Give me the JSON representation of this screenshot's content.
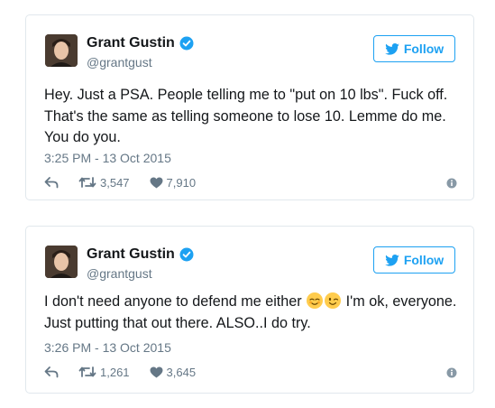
{
  "colors": {
    "accent": "#1da1f2",
    "secondary_text": "#657786",
    "border": "#e1e8ed"
  },
  "tweets": [
    {
      "author": {
        "display_name": "Grant Gustin",
        "handle": "@grantgust",
        "verified": true
      },
      "follow_label": "Follow",
      "text": "Hey. Just a PSA. People telling me to \"put on 10 lbs\". Fuck off. That's the same as telling someone to lose 10. Lemme do me. You do you.",
      "timestamp": "3:25 PM - 13 Oct 2015",
      "retweets": "3,547",
      "likes": "7,910",
      "icons": [
        "reply-icon",
        "retweet-icon",
        "heart-icon",
        "info-icon"
      ]
    },
    {
      "author": {
        "display_name": "Grant Gustin",
        "handle": "@grantgust",
        "verified": true
      },
      "follow_label": "Follow",
      "text_before_emoji": "I don't need anyone to defend me either",
      "emojis": [
        "relieved-face-emoji",
        "winking-face-emoji"
      ],
      "text_after_emoji": " I'm ok, everyone. Just putting that out there. ALSO..I do try.",
      "timestamp": "3:26 PM - 13 Oct 2015",
      "retweets": "1,261",
      "likes": "3,645",
      "icons": [
        "reply-icon",
        "retweet-icon",
        "heart-icon",
        "info-icon"
      ]
    }
  ]
}
